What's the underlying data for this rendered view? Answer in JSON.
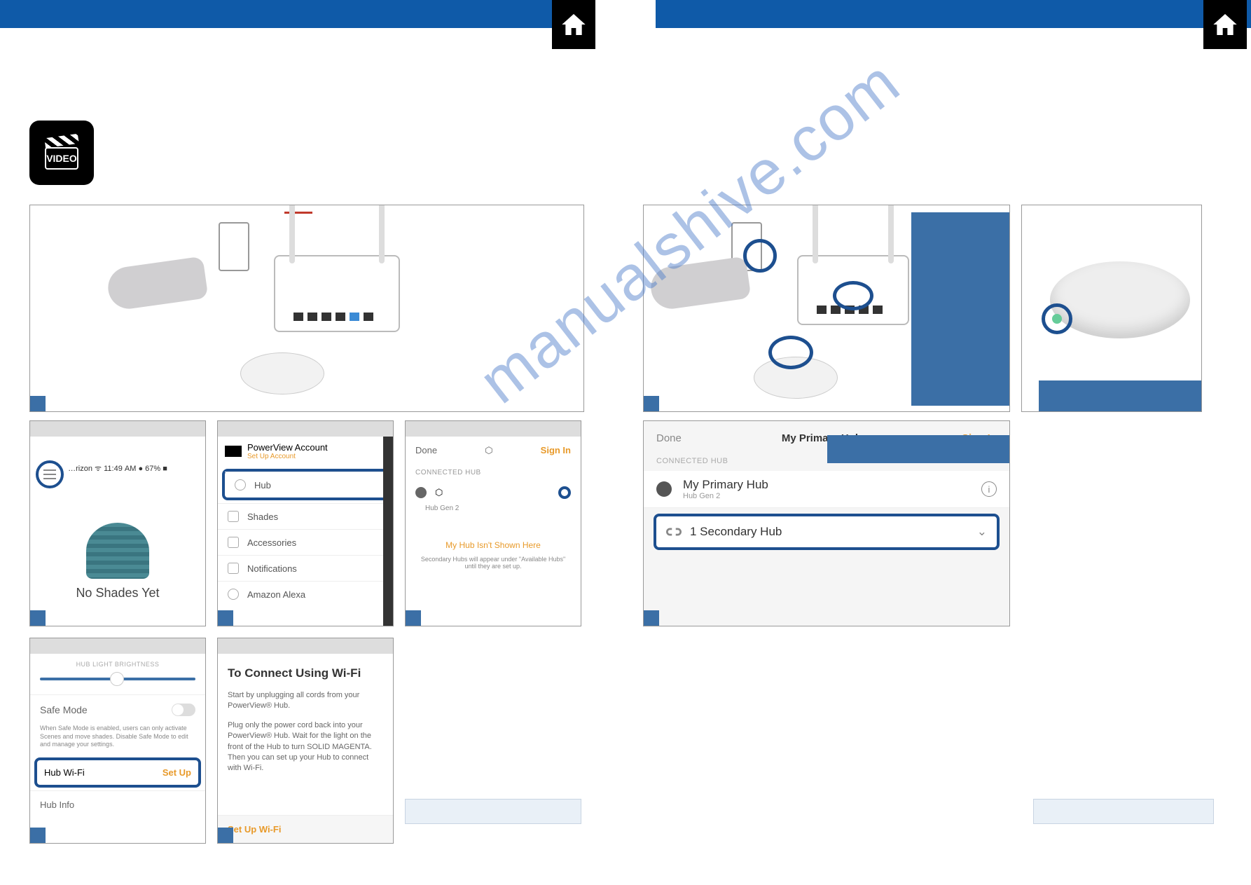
{
  "video_icon_label": "VIDEO",
  "watermark": "manualshive.com",
  "p2": {
    "status": "…rizon ᯤ   11:49 AM    ● 67% ■",
    "message": "No Shades Yet"
  },
  "p3": {
    "account_title": "PowerView Account",
    "account_sub": "Set Up Account",
    "items": {
      "hub": "Hub",
      "shades": "Shades",
      "accessories": "Accessories",
      "notifications": "Notifications",
      "alexa": "Amazon Alexa"
    }
  },
  "p4": {
    "done": "Done",
    "signin": "Sign In",
    "section": "CONNECTED HUB",
    "hub_sub": "Hub Gen 2",
    "msg": "My Hub Isn't Shown Here",
    "desc": "Secondary Hubs will appear under \"Available Hubs\" until they are set up."
  },
  "p5": {
    "brightness_label": "HUB LIGHT BRIGHTNESS",
    "safe_mode": "Safe Mode",
    "safe_desc": "When Safe Mode is enabled, users can only activate Scenes and move shades. Disable Safe Mode to edit and manage your settings.",
    "wifi": "Hub Wi-Fi",
    "setup": "Set Up",
    "hub_info": "Hub Info"
  },
  "p6": {
    "title": "To Connect Using Wi-Fi",
    "para1": "Start by unplugging all cords from your PowerView® Hub.",
    "para2": "Plug only the power cord back into your PowerView® Hub. Wait for the light on the front of the Hub to turn SOLID MAGENTA. Then you can set up your Hub to connect with Wi-Fi.",
    "button": "Set Up Wi-Fi"
  },
  "r3": {
    "done": "Done",
    "title": "My Primary Hub",
    "signin": "Sign In",
    "section": "CONNECTED HUB",
    "hub_name": "My Primary Hub",
    "hub_gen": "Hub Gen 2",
    "info_glyph": "i",
    "secondary": "1 Secondary Hub",
    "chevron": "⌄"
  }
}
